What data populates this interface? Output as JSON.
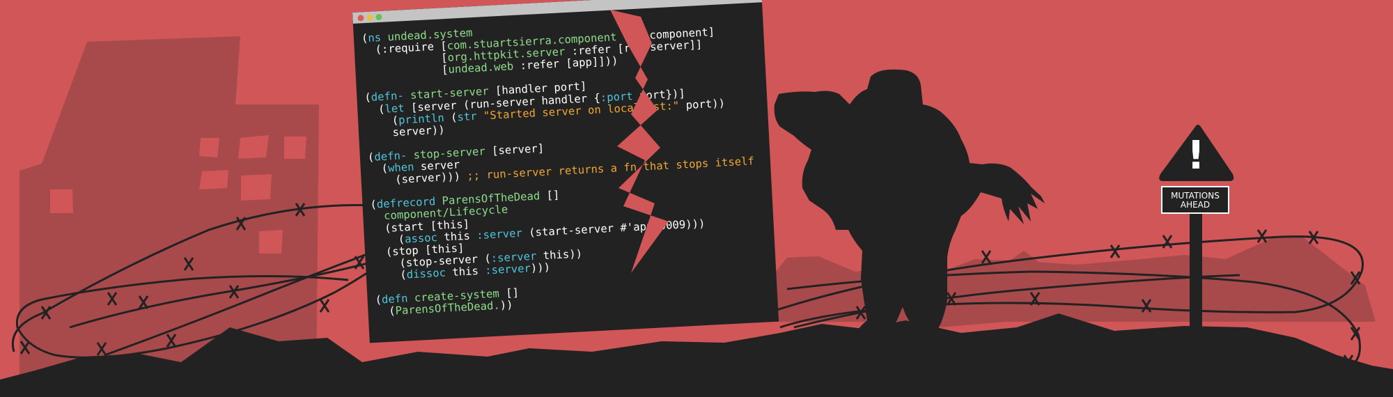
{
  "code_window": {
    "lines": [
      [
        [
          "p",
          "("
        ],
        [
          "kw",
          "ns "
        ],
        [
          "nm",
          "undead.system"
        ]
      ],
      [
        [
          "p",
          "  (:require ["
        ],
        [
          "nm",
          "com.stuartsierra.component"
        ],
        [
          "p",
          " :as component]"
        ]
      ],
      [
        [
          "p",
          "            ["
        ],
        [
          "nm",
          "org.httpkit.server"
        ],
        [
          "p",
          " :refer [run-server]]"
        ]
      ],
      [
        [
          "p",
          "            ["
        ],
        [
          "nm",
          "undead.web"
        ],
        [
          "p",
          " :refer [app]]))"
        ]
      ],
      [
        [
          "p",
          ""
        ]
      ],
      [
        [
          "p",
          "("
        ],
        [
          "kw",
          "defn- "
        ],
        [
          "nm",
          "start-server"
        ],
        [
          "p",
          " [handler port]"
        ]
      ],
      [
        [
          "p",
          "  ("
        ],
        [
          "kw",
          "let"
        ],
        [
          "p",
          " [server (run-server handler {"
        ],
        [
          "kw",
          ":port"
        ],
        [
          "p",
          " port})]"
        ]
      ],
      [
        [
          "p",
          "    ("
        ],
        [
          "kw",
          "println"
        ],
        [
          "p",
          " ("
        ],
        [
          "kw",
          "str"
        ],
        [
          "p",
          " "
        ],
        [
          "st",
          "\"Started server on localhost:\""
        ],
        [
          "p",
          " port))"
        ]
      ],
      [
        [
          "p",
          "    server))"
        ]
      ],
      [
        [
          "p",
          ""
        ]
      ],
      [
        [
          "p",
          "("
        ],
        [
          "kw",
          "defn- "
        ],
        [
          "nm",
          "stop-server"
        ],
        [
          "p",
          " [server]"
        ]
      ],
      [
        [
          "p",
          "  ("
        ],
        [
          "kw",
          "when"
        ],
        [
          "p",
          " server"
        ]
      ],
      [
        [
          "p",
          "    (server))) "
        ],
        [
          "cm",
          ";; run-server returns a fn that stops itself"
        ]
      ],
      [
        [
          "p",
          ""
        ]
      ],
      [
        [
          "p",
          "("
        ],
        [
          "kw",
          "defrecord "
        ],
        [
          "nm",
          "ParensOfTheDead"
        ],
        [
          "p",
          " []"
        ]
      ],
      [
        [
          "p",
          "  "
        ],
        [
          "nm",
          "component/Lifecycle"
        ]
      ],
      [
        [
          "p",
          "  (start [this]"
        ]
      ],
      [
        [
          "p",
          "    ("
        ],
        [
          "kw",
          "assoc"
        ],
        [
          "p",
          " this "
        ],
        [
          "kw",
          ":server"
        ],
        [
          "p",
          " (start-server #'app 9009)))"
        ]
      ],
      [
        [
          "p",
          "  (stop [this]"
        ]
      ],
      [
        [
          "p",
          "    (stop-server ("
        ],
        [
          "kw",
          ":server"
        ],
        [
          "p",
          " this))"
        ]
      ],
      [
        [
          "p",
          "    ("
        ],
        [
          "kw",
          "dissoc"
        ],
        [
          "p",
          " this "
        ],
        [
          "kw",
          ":server"
        ],
        [
          "p",
          ")))"
        ]
      ],
      [
        [
          "p",
          ""
        ]
      ],
      [
        [
          "p",
          "("
        ],
        [
          "kw",
          "defn "
        ],
        [
          "nm",
          "create-system"
        ],
        [
          "p",
          " []"
        ]
      ],
      [
        [
          "p",
          "  ("
        ],
        [
          "nm",
          "ParensOfTheDead."
        ],
        [
          "p",
          "))"
        ]
      ]
    ]
  },
  "sign": {
    "mark": "!",
    "line1": "MUTATIONS",
    "line2": "AHEAD"
  },
  "colors": {
    "background": "#d05658",
    "silhouette": "#222222",
    "far_hills": "#a84a4c",
    "buildings": "#a84a4c",
    "windows": "#d05658",
    "code_keyword": "#4fc5db",
    "code_name": "#8fdb8c",
    "code_string": "#f0a636"
  }
}
